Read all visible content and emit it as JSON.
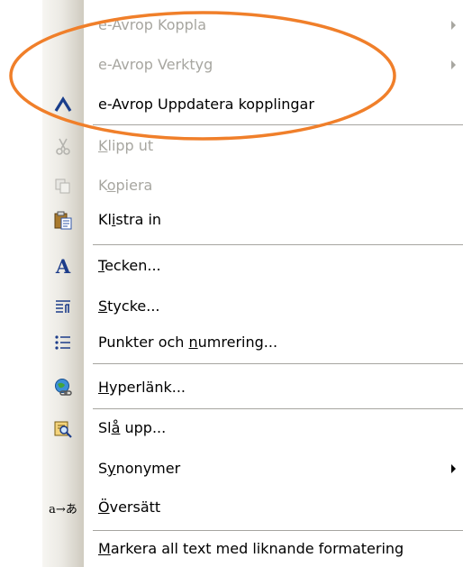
{
  "items": [
    {
      "label": "e-Avrop Koppla",
      "disabled": true,
      "submenu": true,
      "icon": "none"
    },
    {
      "label": "e-Avrop Verktyg",
      "disabled": true,
      "submenu": true,
      "icon": "none"
    },
    {
      "label": "e-Avrop Uppdatera kopplingar",
      "disabled": false,
      "icon": "caret-up-icon"
    },
    {
      "label_pre": "",
      "label_u": "K",
      "label_post": "lipp ut",
      "disabled": true,
      "icon": "scissors-icon"
    },
    {
      "label_pre": "K",
      "label_u": "o",
      "label_post": "piera",
      "disabled": true,
      "icon": "copy-icon"
    },
    {
      "label_pre": "Kl",
      "label_u": "i",
      "label_post": "stra in",
      "disabled": false,
      "icon": "paste-icon"
    },
    {
      "label_pre": "",
      "label_u": "T",
      "label_post": "ecken...",
      "disabled": false,
      "icon": "font-icon"
    },
    {
      "label_pre": "",
      "label_u": "S",
      "label_post": "tycke...",
      "disabled": false,
      "icon": "paragraph-icon"
    },
    {
      "label_pre": "Punkter och ",
      "label_u": "n",
      "label_post": "umrering...",
      "disabled": false,
      "icon": "bullets-icon"
    },
    {
      "label_pre": "",
      "label_u": "H",
      "label_post": "yperlänk...",
      "disabled": false,
      "icon": "hyperlink-icon"
    },
    {
      "label_pre": "Sl",
      "label_u": "å",
      "label_post": " upp...",
      "disabled": false,
      "icon": "lookup-icon"
    },
    {
      "label_pre": "S",
      "label_u": "y",
      "label_post": "nonymer",
      "disabled": false,
      "submenu": true,
      "icon": "none"
    },
    {
      "label_pre": "",
      "label_u": "Ö",
      "label_post": "versätt",
      "disabled": false,
      "icon": "translate-icon"
    },
    {
      "label_pre": "",
      "label_u": "M",
      "label_post": "arkera all text med liknande formatering",
      "disabled": false,
      "icon": "none"
    }
  ],
  "colors": {
    "disabled_text": "#a7a6a0",
    "highlight_ring": "#f07f2a",
    "gutter": "#e8e6df"
  },
  "font_icon_glyph": "A",
  "translate_glyph": "a→あ"
}
